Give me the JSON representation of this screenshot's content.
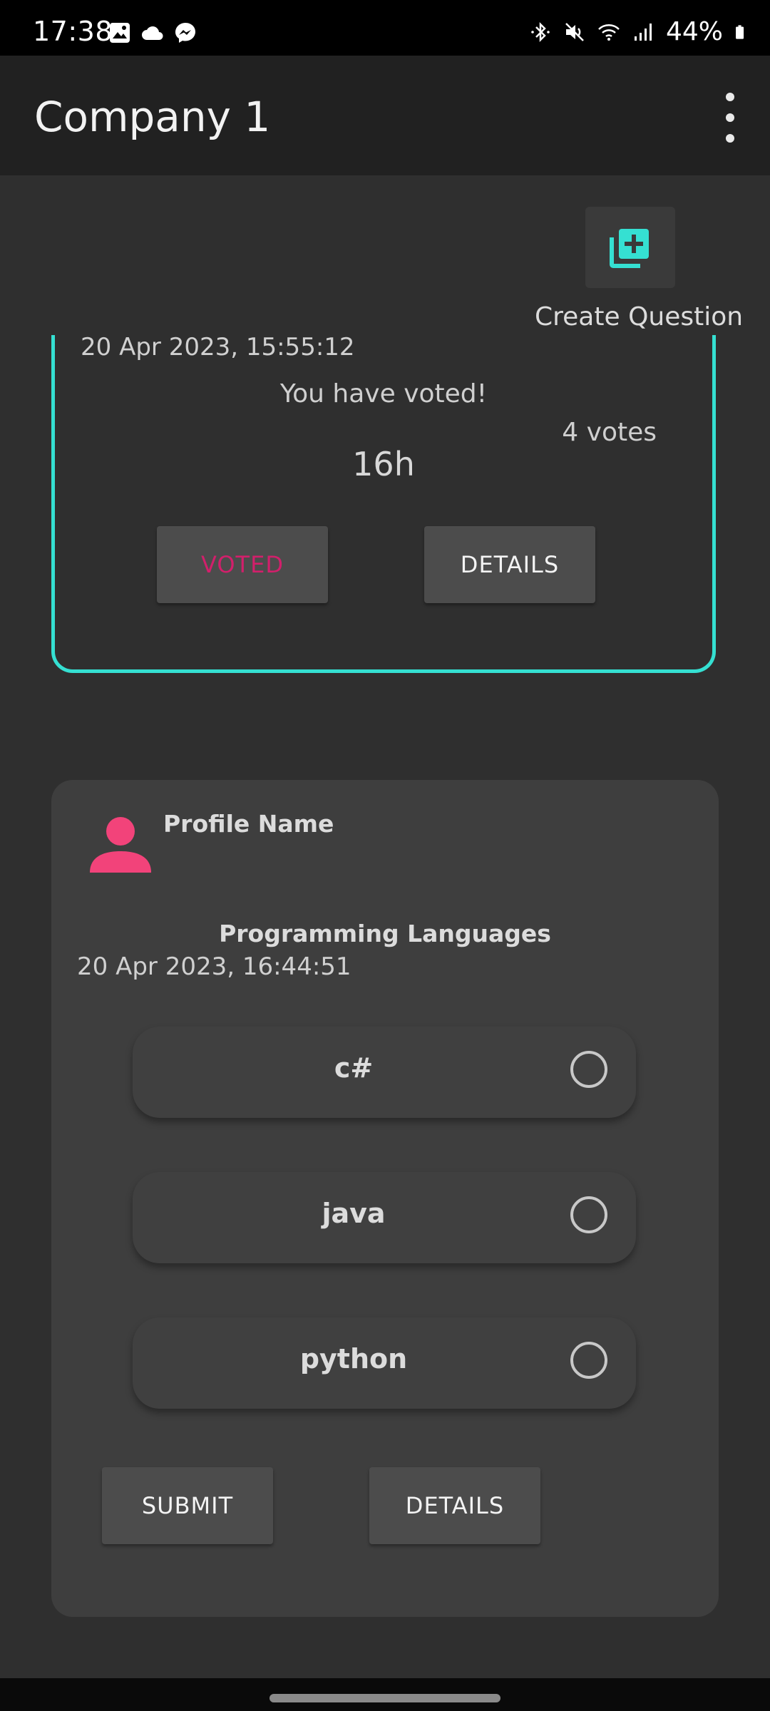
{
  "status_bar": {
    "time": "17:38",
    "battery": "44%",
    "left_icons": [
      "image-icon",
      "cloud-icon",
      "messenger-icon"
    ],
    "right_icons": [
      "bluetooth-icon",
      "mute-icon",
      "wifi-icon",
      "signal-icon",
      "battery-icon"
    ]
  },
  "app_bar": {
    "title": "Company 1",
    "menu_icon": "more-vert-icon"
  },
  "create_question": {
    "label": "Create Question",
    "icon": "library-add-icon",
    "accent_color": "#35e0d2"
  },
  "voted_card": {
    "date": "20 Apr 2023, 15:55:12",
    "message": "You have voted!",
    "votes": "4 votes",
    "time_left": "16h",
    "voted_button": "VOTED",
    "details_button": "DETAILS",
    "border_color": "#35e0d2",
    "voted_text_color": "#d21f6b"
  },
  "poll_card": {
    "profile_name": "Profile Name",
    "avatar_icon": "person-icon",
    "avatar_color": "#f2437a",
    "title": "Programming Languages",
    "date": "20 Apr 2023, 16:44:51",
    "options": [
      {
        "label": "c#",
        "selected": false
      },
      {
        "label": "java",
        "selected": false
      },
      {
        "label": "python",
        "selected": false
      }
    ],
    "submit_button": "SUBMIT",
    "details_button": "DETAILS"
  }
}
